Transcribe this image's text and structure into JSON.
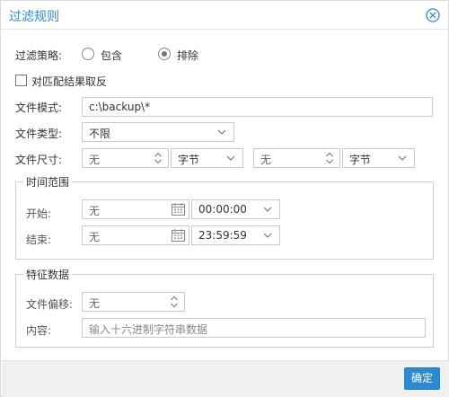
{
  "dialog": {
    "title": "过滤规则"
  },
  "strategy": {
    "label": "过滤策略:",
    "options": [
      {
        "label": "包含",
        "selected": false
      },
      {
        "label": "排除",
        "selected": true
      }
    ]
  },
  "invert": {
    "label": "对匹配结果取反",
    "checked": false
  },
  "file_pattern": {
    "label": "文件模式:",
    "value": "c:\\backup\\*"
  },
  "file_type": {
    "label": "文件类型:",
    "value": "不限"
  },
  "file_size": {
    "label": "文件尺寸:",
    "min_value": "无",
    "min_unit": "字节",
    "max_value": "无",
    "max_unit": "字节"
  },
  "time_range": {
    "title": "时间范围",
    "start": {
      "label": "开始:",
      "date": "无",
      "time": "00:00:00"
    },
    "end": {
      "label": "结束:",
      "date": "无",
      "time": "23:59:59"
    }
  },
  "signature": {
    "title": "特征数据",
    "offset_label": "文件偏移:",
    "offset_value": "无",
    "content_label": "内容:",
    "content_placeholder": "输入十六进制字符串数据"
  },
  "footer": {
    "ok_label": "确定"
  },
  "colors": {
    "accent": "#2d8ad0",
    "footer_bg": "#f0f0f0"
  },
  "icons": {
    "close": "close-circle-icon",
    "dropdown": "chevron-down-icon",
    "spinner": "spinner-arrows-icon",
    "calendar": "calendar-icon"
  }
}
